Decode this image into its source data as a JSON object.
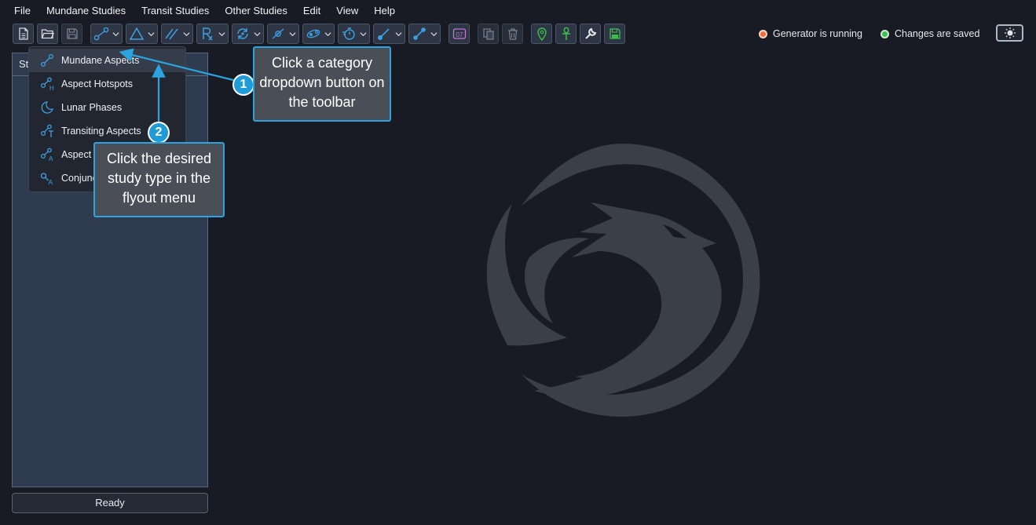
{
  "menu": [
    "File",
    "Mundane Studies",
    "Transit Studies",
    "Other Studies",
    "Edit",
    "View",
    "Help"
  ],
  "status": {
    "generator": "Generator is running",
    "saved": "Changes are saved"
  },
  "left_panel": {
    "header": "St"
  },
  "ready_label": "Ready",
  "toolbar": {
    "calendar_day": "07"
  },
  "flyout": {
    "items": [
      {
        "label": "Mundane Aspects",
        "icon": "mundane-aspects-icon"
      },
      {
        "label": "Aspect Hotspots",
        "icon": "aspect-hotspots-icon"
      },
      {
        "label": "Lunar Phases",
        "icon": "moon-icon"
      },
      {
        "label": "Transiting Aspects",
        "icon": "transiting-aspects-icon"
      },
      {
        "label": "Aspect",
        "icon": "aspect-a-icon"
      },
      {
        "label": "Conjunc",
        "icon": "conjunction-a-icon"
      }
    ]
  },
  "callouts": {
    "one": {
      "number": "1",
      "text": "Click a category dropdown button on the toolbar"
    },
    "two": {
      "number": "2",
      "text": "Click the desired study type in the flyout menu"
    }
  },
  "colors": {
    "accent": "#2aa3de",
    "icon_blue": "#3e9fe0",
    "icon_green": "#3cc04d",
    "icon_purple": "#c276d6",
    "generator_dot": "#f26c3c",
    "saved_dot": "#3cc04d"
  }
}
